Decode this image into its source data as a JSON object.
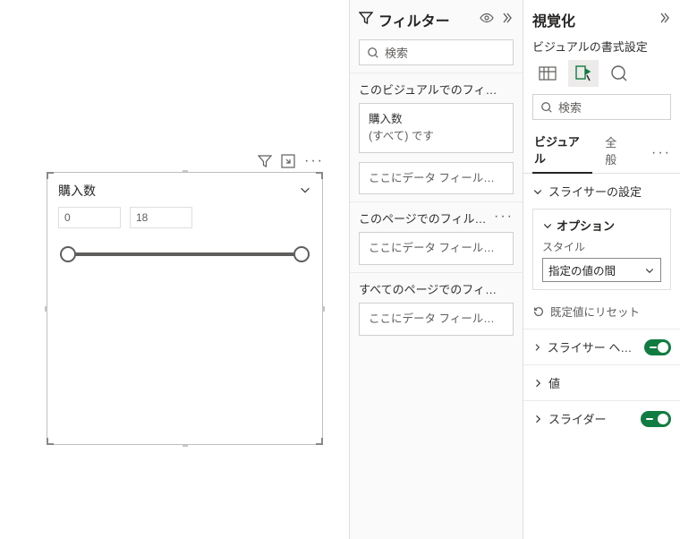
{
  "canvas": {
    "visual_title": "購入数",
    "slider_min": "0",
    "slider_max": "18"
  },
  "filters": {
    "title": "フィルター",
    "search_placeholder": "検索",
    "sections": {
      "visual": {
        "label": "このビジュアルでのフィルター…",
        "field": "購入数",
        "condition": "(すべて) です",
        "placeholder": "ここにデータ フィールド…"
      },
      "page": {
        "label": "このページでのフィルター",
        "placeholder": "ここにデータ フィールド…"
      },
      "all": {
        "label": "すべてのページでのフィルター…",
        "placeholder": "ここにデータ フィールド…"
      }
    }
  },
  "viz": {
    "title": "視覚化",
    "subtitle": "ビジュアルの書式設定",
    "search_placeholder": "検索",
    "tabs": {
      "visual": "ビジュアル",
      "general": "全般"
    },
    "slicer_settings": "スライサーの設定",
    "options_title": "オプション",
    "options_style_label": "スタイル",
    "options_style_value": "指定の値の間",
    "reset": "既定値にリセット",
    "rows": {
      "header": "スライサー ヘッ…",
      "value": "値",
      "slider": "スライダー"
    }
  }
}
